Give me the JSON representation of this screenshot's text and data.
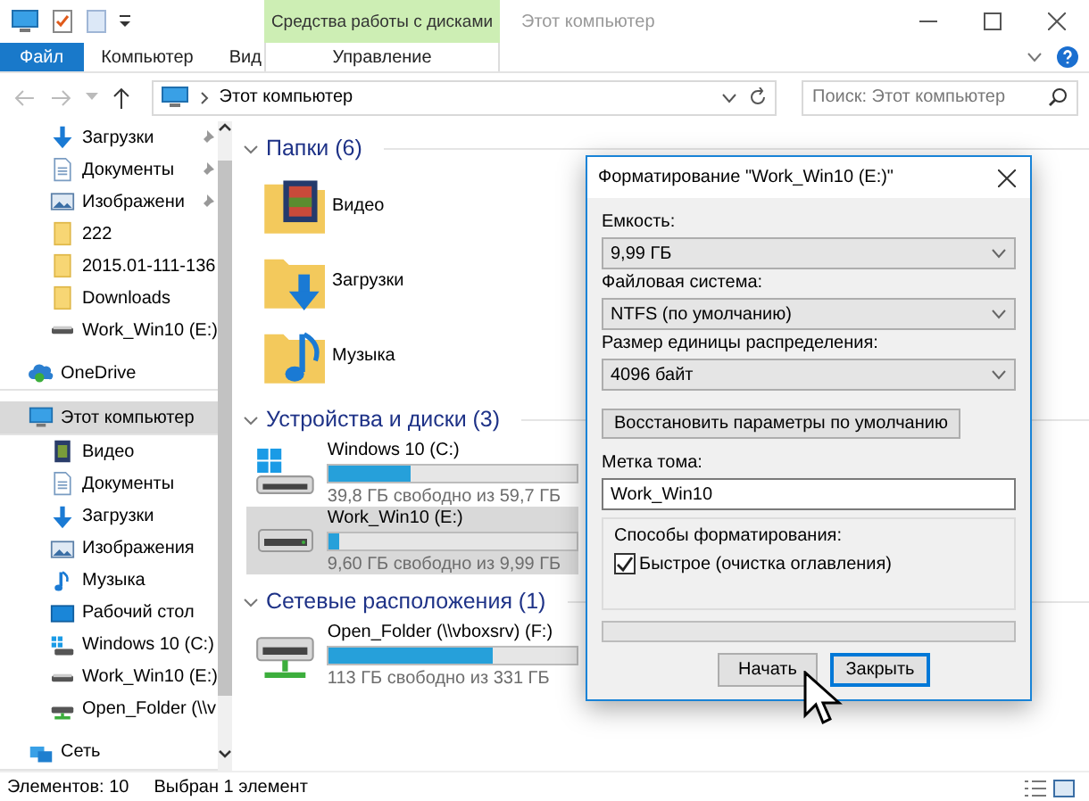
{
  "title_bar": {
    "tool_tab": "Средства работы с дисками",
    "title": "Этот компьютер"
  },
  "ribbon_tabs": [
    {
      "label": "Файл",
      "kind": "file"
    },
    {
      "label": "Компьютер",
      "kind": "normal"
    },
    {
      "label": "Вид",
      "kind": "normal"
    },
    {
      "label": "Управление",
      "kind": "context"
    }
  ],
  "address_bar": {
    "path": "Этот компьютер"
  },
  "search": {
    "placeholder": "Поиск: Этот компьютер"
  },
  "sidebar": {
    "pinned_items": [
      {
        "label": "Загрузки",
        "kind": "download",
        "pinned": true
      },
      {
        "label": "Документы",
        "kind": "document",
        "pinned": true
      },
      {
        "label": "Изображени",
        "kind": "picture",
        "pinned": true
      },
      {
        "label": "222",
        "kind": "folder",
        "pinned": false
      },
      {
        "label": "2015.01-111-136",
        "kind": "folder",
        "pinned": false
      },
      {
        "label": "Downloads",
        "kind": "folder",
        "pinned": false
      },
      {
        "label": "Work_Win10 (E:)",
        "kind": "drive",
        "pinned": false
      }
    ],
    "tree": [
      {
        "label": "OneDrive",
        "kind": "onedrive",
        "selected": false
      },
      {
        "label": "Этот компьютер",
        "kind": "computer",
        "selected": true,
        "children": [
          {
            "label": "Видео",
            "kind": "video",
            "selected": false
          },
          {
            "label": "Документы",
            "kind": "document",
            "selected": false
          },
          {
            "label": "Загрузки",
            "kind": "download",
            "selected": false
          },
          {
            "label": "Изображения",
            "kind": "picture",
            "selected": false
          },
          {
            "label": "Музыка",
            "kind": "music",
            "selected": false
          },
          {
            "label": "Рабочий стол",
            "kind": "desktop",
            "selected": false
          },
          {
            "label": "Windows 10 (C:)",
            "kind": "windows",
            "selected": false
          },
          {
            "label": "Work_Win10 (E:)",
            "kind": "drive",
            "selected": false
          },
          {
            "label": "Open_Folder (\\\\v",
            "kind": "netdrive",
            "selected": false
          }
        ]
      },
      {
        "label": "Сеть",
        "kind": "network",
        "selected": false
      }
    ]
  },
  "groups": [
    {
      "title": "Папки (6)",
      "expanded": true,
      "kind": "folders",
      "items": [
        {
          "label": "Видео",
          "kind": "video"
        },
        {
          "label": "Загрузки",
          "kind": "download"
        },
        {
          "label": "Музыка",
          "kind": "music"
        }
      ]
    },
    {
      "title": "Устройства и диски (3)",
      "expanded": true,
      "kind": "drives",
      "items": [
        {
          "label": "Windows 10 (C:)",
          "kind": "windows",
          "free": "39,8 ГБ свободно из 59,7 ГБ",
          "level": 0.33,
          "selected": false
        },
        {
          "label": "Work_Win10 (E:)",
          "kind": "drive",
          "free": "9,60 ГБ свободно из 9,99 ГБ",
          "level": 0.04,
          "selected": true
        }
      ]
    },
    {
      "title": "Сетевые расположения (1)",
      "expanded": true,
      "kind": "drives",
      "items": [
        {
          "label": "Open_Folder (\\\\vboxsrv) (F:)",
          "kind": "netdrive",
          "free": "113 ГБ свободно из 331 ГБ",
          "level": 0.66,
          "selected": false
        }
      ]
    }
  ],
  "dialog": {
    "title": "Форматирование \"Work_Win10 (E:)\"",
    "fields": [
      {
        "label": "Емкость:",
        "value": "9,99 ГБ"
      },
      {
        "label": "Файловая система:",
        "value": "NTFS (по умолчанию)"
      },
      {
        "label": "Размер единицы распределения:",
        "value": "4096 байт"
      }
    ],
    "restore_button": "Восстановить параметры по умолчанию",
    "volume_label": {
      "label": "Метка тома:",
      "value": "Work_Win10"
    },
    "format_options": {
      "title": "Способы форматирования:",
      "options": [
        {
          "label": "Быстрое (очистка оглавления)",
          "checked": true
        }
      ]
    },
    "progress": {
      "level": 0
    },
    "buttons": [
      {
        "label": "Начать",
        "default": false
      },
      {
        "label": "Закрыть",
        "default": true
      }
    ]
  },
  "status_bar": {
    "item_count": "Элементов: 10",
    "selection": "Выбран 1 элемент"
  }
}
